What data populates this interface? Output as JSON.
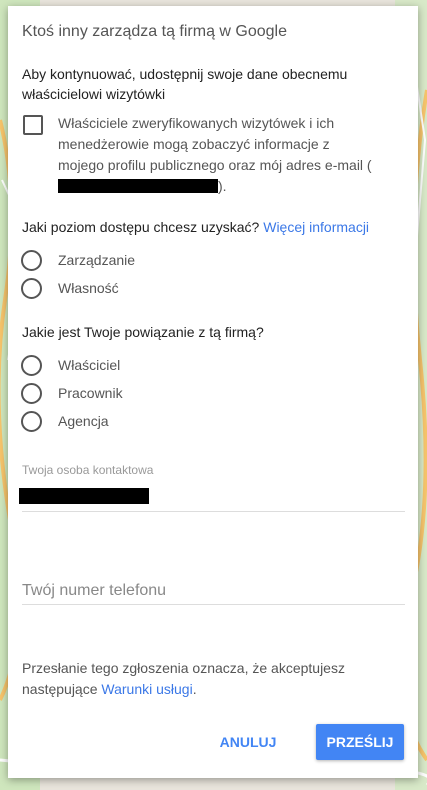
{
  "dialog": {
    "title": "Ktoś inny zarządza tą firmą w Google",
    "share_heading": "Aby kontynuować, udostępnij swoje dane obecnemu właścicielowi wizytówki",
    "checkbox": {
      "text_before": "Właściciele zweryfikowanych wizytówek i ich menedżerowie mogą zobaczyć informacje z mojego profilu publicznego oraz mój adres e-mail (",
      "text_after": ").",
      "checked": false
    },
    "access": {
      "question": "Jaki poziom dostępu chcesz uzyskać?",
      "more_info": "Więcej informacji",
      "options": [
        "Zarządzanie",
        "Własność"
      ]
    },
    "relation": {
      "question": "Jakie jest Twoje powiązanie z tą firmą?",
      "options": [
        "Właściciel",
        "Pracownik",
        "Agencja"
      ]
    },
    "contact": {
      "label": "Twoja osoba kontaktowa"
    },
    "phone": {
      "placeholder": "Twój numer telefonu"
    },
    "terms": {
      "text": "Przesłanie tego zgłoszenia oznacza, że akceptujesz następujące ",
      "link": "Warunki usługi",
      "end": "."
    },
    "buttons": {
      "cancel": "ANULUJ",
      "submit": "PRZEŚLIJ"
    }
  },
  "colors": {
    "accent": "#4285f4",
    "link": "#3b78e7"
  }
}
